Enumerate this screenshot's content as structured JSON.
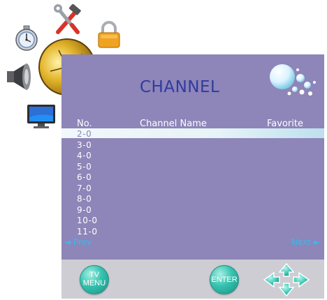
{
  "panel": {
    "title": "CHANNEL",
    "columns": {
      "number": "No.",
      "name": "Channel Name",
      "favorite": "Favorite"
    },
    "rows": [
      {
        "number": "2-0",
        "name": "",
        "favorite": ""
      },
      {
        "number": "3-0",
        "name": "",
        "favorite": ""
      },
      {
        "number": "4-0",
        "name": "",
        "favorite": ""
      },
      {
        "number": "5-0",
        "name": "",
        "favorite": ""
      },
      {
        "number": "6-0",
        "name": "",
        "favorite": ""
      },
      {
        "number": "7-0",
        "name": "",
        "favorite": ""
      },
      {
        "number": "8-0",
        "name": "",
        "favorite": ""
      },
      {
        "number": "9-0",
        "name": "",
        "favorite": ""
      },
      {
        "number": "10-0",
        "name": "",
        "favorite": ""
      },
      {
        "number": "11-0",
        "name": "",
        "favorite": ""
      }
    ],
    "selected_row_index": 0,
    "prev_label": "◄ Prev",
    "next_label": "Next ►"
  },
  "bottom": {
    "tv_menu_line1": "TV",
    "tv_menu_line2": "MENU",
    "enter_label": "ENTER"
  },
  "icons": [
    "stopwatch-icon",
    "tools-icon",
    "lock-icon",
    "speaker-icon",
    "satellite-dish-icon",
    "monitor-icon",
    "bubbles-icon",
    "arrow-keys-icon"
  ],
  "colors": {
    "panel_bg": "#8e85b8",
    "title": "#2f3ba0",
    "nav_link": "#3fb6ee",
    "bottom_bar": "#cdcdd3",
    "button_teal": "#34c2ae"
  }
}
